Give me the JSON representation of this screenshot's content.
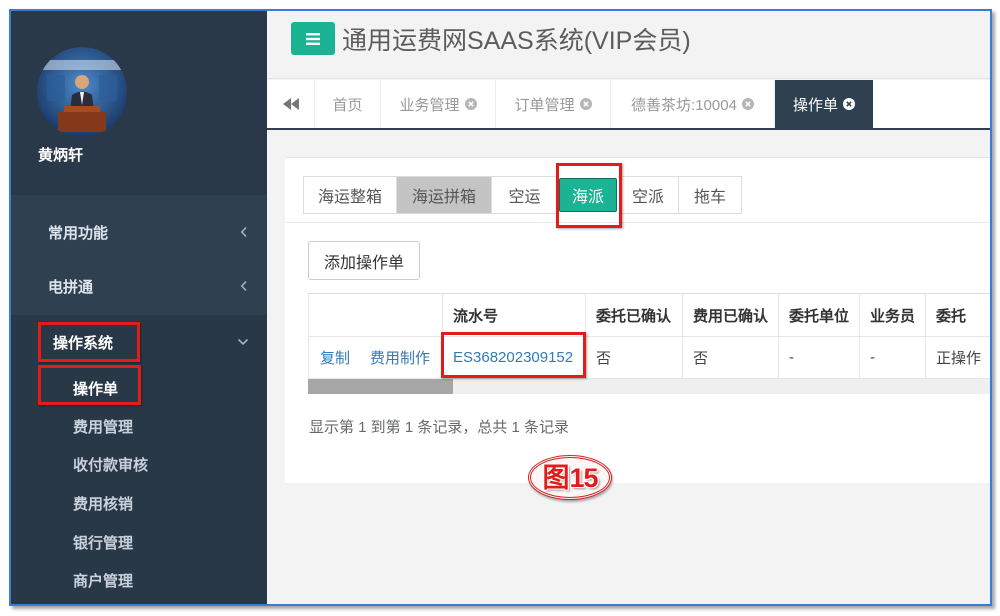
{
  "colors": {
    "sidebar": "#2f4050",
    "sidebar_dark": "#293846",
    "profile": "#2a394a",
    "accent": "#1ab394",
    "highlight": "#e31b1b",
    "link": "#337ab7",
    "frame": "#3d7bd9"
  },
  "app": {
    "title": "通用运费网SAAS系统(VIP会员)",
    "menu_icon": "hamburger-icon"
  },
  "user": {
    "name": "黄炳轩"
  },
  "sidebar": {
    "items": [
      {
        "label": "常用功能",
        "icon": "chevron-left-icon"
      },
      {
        "label": "电拼通",
        "icon": "chevron-left-icon"
      },
      {
        "label": "操作系统",
        "icon": "chevron-down-icon",
        "expanded": true
      }
    ],
    "submenu": [
      {
        "label": "操作单",
        "active": true
      },
      {
        "label": "费用管理"
      },
      {
        "label": "收付款审核"
      },
      {
        "label": "费用核销"
      },
      {
        "label": "银行管理"
      },
      {
        "label": "商户管理"
      }
    ]
  },
  "page_tabs": {
    "back_icon": "double-left-icon",
    "close_icon": "close-icon",
    "items": [
      {
        "label": "首页",
        "closable": false
      },
      {
        "label": "业务管理",
        "closable": true
      },
      {
        "label": "订单管理",
        "closable": true
      },
      {
        "label": "德善茶坊:10004",
        "closable": true
      },
      {
        "label": "操作单",
        "closable": true,
        "active": true
      }
    ]
  },
  "content": {
    "type_tabs": [
      {
        "label": "海运整箱"
      },
      {
        "label": "海运拼箱",
        "highlighted": true
      },
      {
        "label": "空运"
      },
      {
        "label": "海派",
        "active": true
      },
      {
        "label": "空派"
      },
      {
        "label": "拖车"
      }
    ],
    "add_button": "添加操作单",
    "table": {
      "headers": [
        "",
        "流水号",
        "委托已确认",
        "费用已确认",
        "委托单位",
        "业务员",
        "委托"
      ],
      "rows": [
        {
          "actions": [
            "复制",
            "费用制作"
          ],
          "serial": "ES368202309152",
          "consign_confirmed": "否",
          "fee_confirmed": "否",
          "client": "-",
          "salesperson": "-",
          "consign": "正操作"
        }
      ]
    },
    "pagination_info": "显示第 1 到第 1 条记录，总共 1 条记录"
  },
  "annotation": {
    "prefix": "图",
    "number": "15"
  }
}
